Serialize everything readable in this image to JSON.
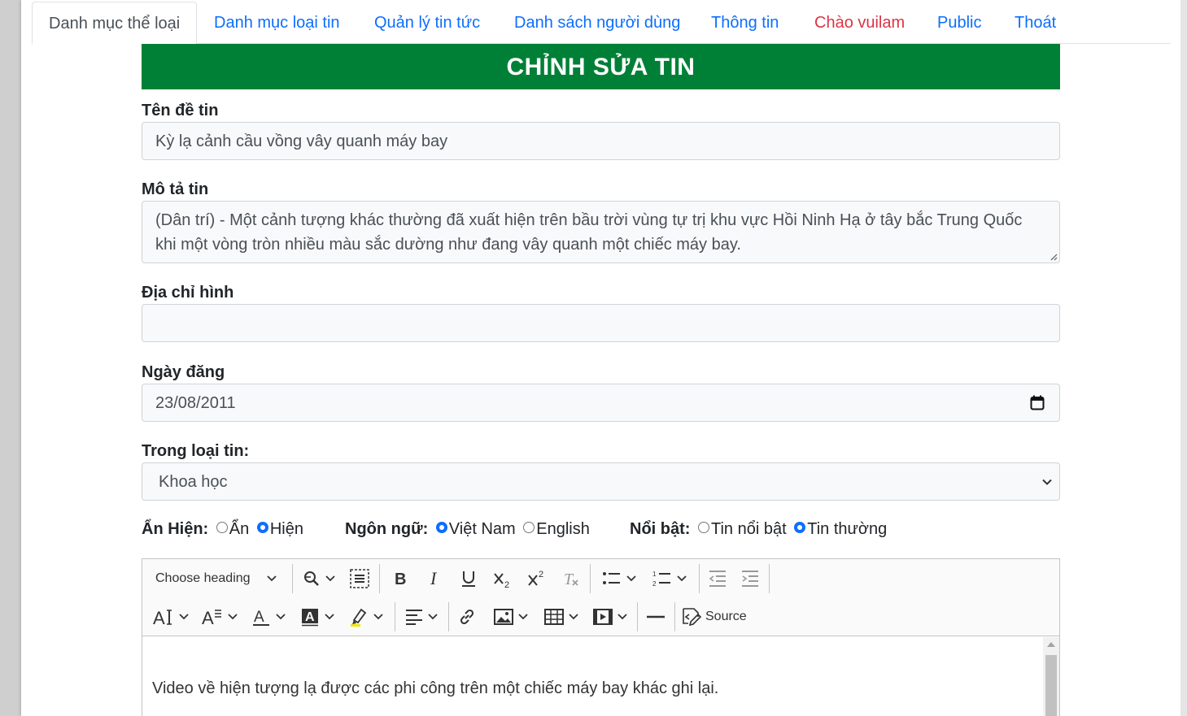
{
  "tabs": [
    {
      "label": "Danh mục thể loại",
      "active": true
    },
    {
      "label": "Danh mục loại tin"
    },
    {
      "label": "Quản lý tin tức"
    },
    {
      "label": "Danh sách người dùng"
    },
    {
      "label": "Thông tin"
    },
    {
      "label": "Chào vuilam",
      "color": "#dc3545"
    },
    {
      "label": "Public"
    },
    {
      "label": "Thoát"
    }
  ],
  "banner": {
    "title": "CHỈNH SỬA TIN",
    "color": "#008037"
  },
  "form": {
    "title_label": "Tên đề tin",
    "title_value": "Kỳ lạ cảnh cầu vồng vây quanh máy bay",
    "desc_label": "Mô tả tin",
    "desc_value": "(Dân trí) - Một cảnh tượng khác thường đã xuất hiện trên bầu trời vùng tự trị khu vực Hồi Ninh Hạ ở tây bắc Trung Quốc khi một vòng tròn nhiều màu sắc dường như đang vây quanh một chiếc máy bay.",
    "image_label": "Địa chỉ hình",
    "image_value": "",
    "date_label": "Ngày đăng",
    "date_value": "23/08/2011",
    "category_label": "Trong loại tin:",
    "category_value": "Khoa học",
    "visibility": {
      "label": "Ẩn Hiện:",
      "options": [
        "Ẩn",
        "Hiện"
      ],
      "selected": "Hiện"
    },
    "language": {
      "label": "Ngôn ngữ:",
      "options": [
        "Việt Nam",
        "English"
      ],
      "selected": "Việt Nam"
    },
    "featured": {
      "label": "Nổi bật:",
      "options": [
        "Tin nổi bật",
        "Tin thường"
      ],
      "selected": "Tin thường"
    }
  },
  "editor": {
    "heading_dropdown": "Choose heading",
    "source_label": "Source",
    "content_text": "Video về hiện tượng lạ được các phi công trên một chiếc máy bay khác ghi lại."
  }
}
